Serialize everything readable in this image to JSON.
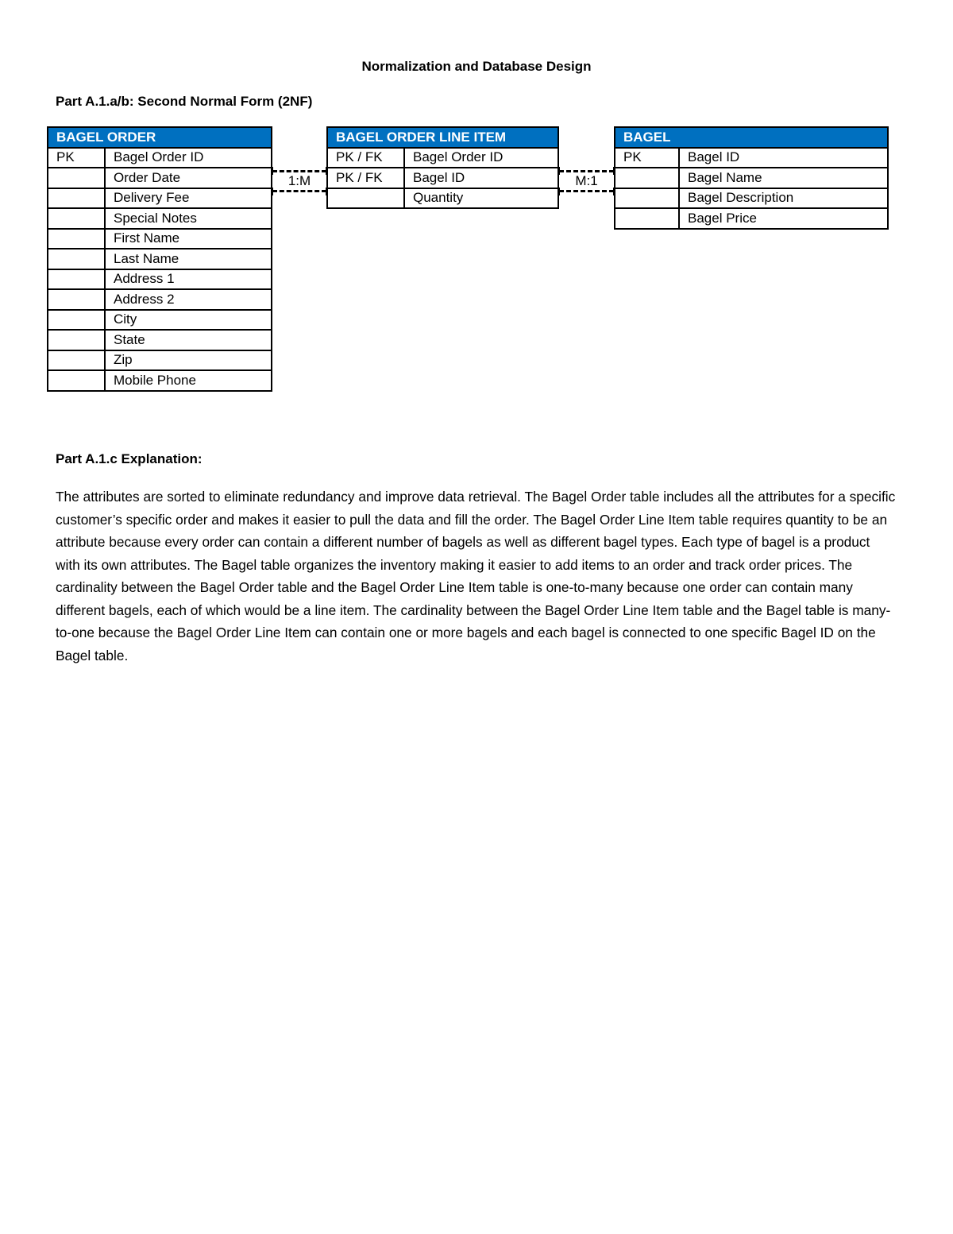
{
  "document": {
    "title": "Normalization and Database Design",
    "section_2nf_heading": "Part A.1.a/b: Second Normal Form (2NF)",
    "section_explanation_heading": "Part A.1.c Explanation:",
    "explanation": "The attributes are sorted to eliminate redundancy and improve data retrieval. The Bagel Order table includes all the attributes for a specific customer’s specific order and makes it easier to pull the data and fill the order. The Bagel Order Line Item table requires quantity to be an attribute because every order can contain a different number of bagels as well as different bagel types. Each type of bagel is a product with its own attributes. The Bagel table organizes the inventory making it easier to add items to an order and track order prices. The cardinality between the Bagel Order table and the Bagel Order Line Item table is one-to-many because one order can contain many different bagels, each of which would be a line item. The cardinality between the Bagel Order Line Item table and the Bagel table is many-to-one because the Bagel Order Line Item can contain one or more bagels and each bagel is connected to one specific Bagel ID on the Bagel table."
  },
  "header_color": "#0070C0",
  "entities": {
    "bagel_order": {
      "name": "BAGEL ORDER",
      "rows": [
        {
          "key": "PK",
          "attribute": "Bagel Order ID"
        },
        {
          "key": "",
          "attribute": "Order Date"
        },
        {
          "key": "",
          "attribute": "Delivery Fee"
        },
        {
          "key": "",
          "attribute": "Special Notes"
        },
        {
          "key": "",
          "attribute": "First Name"
        },
        {
          "key": "",
          "attribute": "Last Name"
        },
        {
          "key": "",
          "attribute": "Address 1"
        },
        {
          "key": "",
          "attribute": "Address 2"
        },
        {
          "key": "",
          "attribute": "City"
        },
        {
          "key": "",
          "attribute": "State"
        },
        {
          "key": "",
          "attribute": "Zip"
        },
        {
          "key": "",
          "attribute": "Mobile Phone"
        }
      ]
    },
    "bagel_order_line_item": {
      "name": "BAGEL ORDER LINE ITEM",
      "rows": [
        {
          "key": "PK / FK",
          "attribute": "Bagel Order ID"
        },
        {
          "key": "PK / FK",
          "attribute": "Bagel ID"
        },
        {
          "key": "",
          "attribute": "Quantity"
        }
      ]
    },
    "bagel": {
      "name": "BAGEL",
      "rows": [
        {
          "key": "PK",
          "attribute": "Bagel ID"
        },
        {
          "key": "",
          "attribute": "Bagel Name"
        },
        {
          "key": "",
          "attribute": "Bagel Description"
        },
        {
          "key": "",
          "attribute": "Bagel Price"
        }
      ]
    }
  },
  "relationships": [
    {
      "from": "BAGEL ORDER",
      "to": "BAGEL ORDER LINE ITEM",
      "cardinality": "1:M"
    },
    {
      "from": "BAGEL ORDER LINE ITEM",
      "to": "BAGEL",
      "cardinality": "M:1"
    }
  ]
}
